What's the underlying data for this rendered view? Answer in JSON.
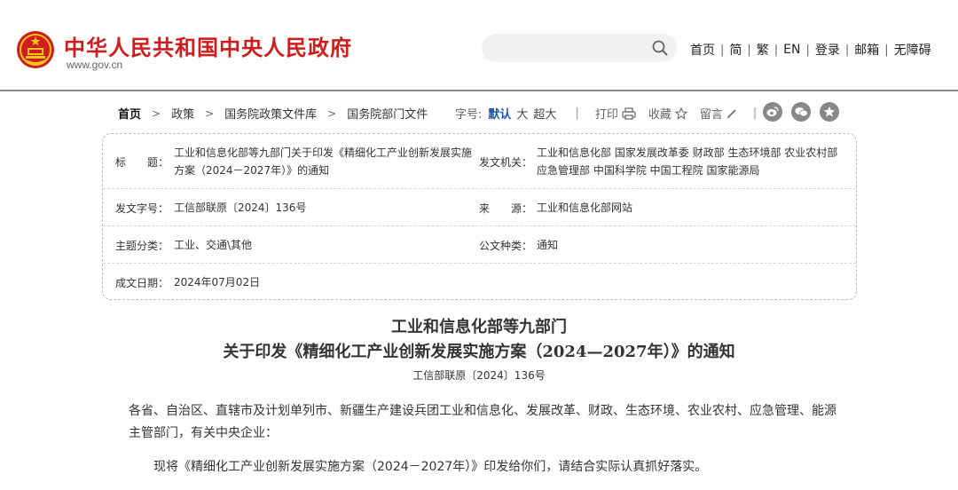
{
  "header": {
    "site_title": "中华人民共和国中央人民政府",
    "site_url": "www.gov.cn",
    "search_placeholder": "",
    "links": [
      "首页",
      "简",
      "繁",
      "EN",
      "登录",
      "邮箱",
      "无障碍"
    ],
    "brand_color": "#d01c1c"
  },
  "breadcrumb": {
    "items": [
      "首页",
      "政策",
      "国务院政策文件库",
      "国务院部门文件"
    ]
  },
  "toolbar": {
    "font_label": "字号:",
    "font_sizes": [
      "默认",
      "大",
      "超大"
    ],
    "font_active": "默认",
    "print_label": "打印",
    "favorite_label": "收藏",
    "comment_label": "留言",
    "share_icons": [
      "weibo-icon",
      "wechat-icon",
      "qzone-icon"
    ]
  },
  "info": {
    "title_label": "标　　题：",
    "title_value": "工业和信息化部等九部门关于印发《精细化工产业创新发展实施方案（2024－2027年）》的通知",
    "issuer_label": "发文机关：",
    "issuer_value": "工业和信息化部 国家发展改革委 财政部 生态环境部 农业农村部 应急管理部 中国科学院 中国工程院 国家能源局",
    "doc_no_label": "发文字号：",
    "doc_no_value": "工信部联原〔2024〕136号",
    "source_label": "来　　源：",
    "source_value": "工业和信息化部网站",
    "topic_label": "主题分类：",
    "topic_value": "工业、交通\\其他",
    "type_label": "公文种类：",
    "type_value": "通知",
    "date_label": "成文日期：",
    "date_value": "2024年07月02日"
  },
  "document": {
    "title_line1": "工业和信息化部等九部门",
    "title_line2": "关于印发《精细化工产业创新发展实施方案（2024—2027年）》的通知",
    "doc_number": "工信部联原〔2024〕136号",
    "paragraph1": "各省、自治区、直辖市及计划单列市、新疆生产建设兵团工业和信息化、发展改革、财政、生态环境、农业农村、应急管理、能源主管部门，有关中央企业：",
    "paragraph2": "现将《精细化工产业创新发展实施方案（2024－2027年）》印发给你们，请结合实际认真抓好落实。"
  }
}
